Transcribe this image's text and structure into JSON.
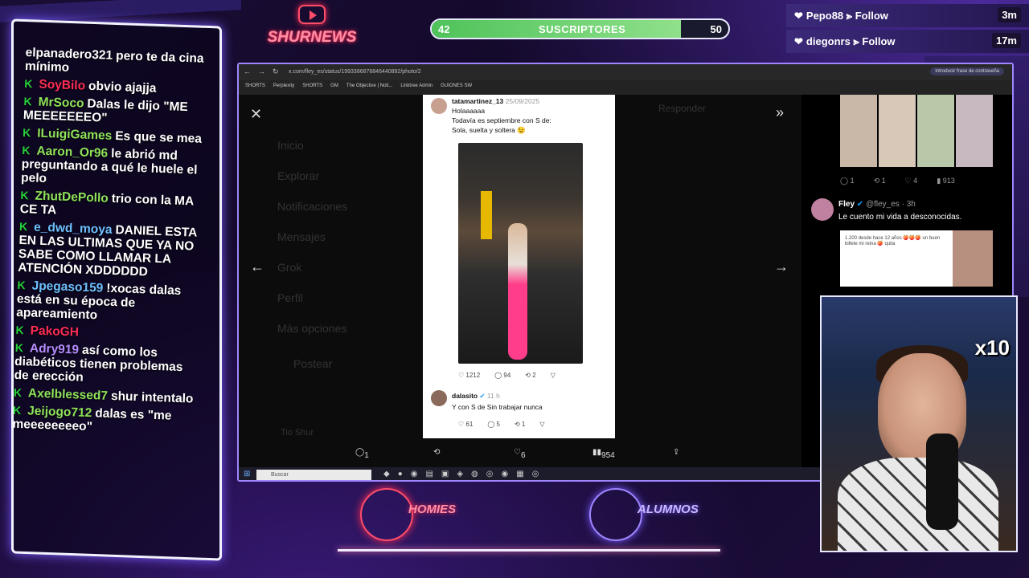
{
  "stream": {
    "logo_text": "SHURNEWS",
    "subs": {
      "current": "42",
      "label": "SUSCRIPTORES",
      "goal": "50",
      "progress": 0.84
    },
    "follows": [
      {
        "user": "Pepo88",
        "action": "Follow",
        "time": "3m"
      },
      {
        "user": "diegonrs",
        "action": "Follow",
        "time": "17m"
      }
    ],
    "x10": "x10",
    "homies": "HOMIES",
    "alumnos": "ALUMNOS"
  },
  "chat": [
    {
      "user": "elpanadero321",
      "color": "#ffffff",
      "text": "pero te da cina mínimo",
      "badge": false
    },
    {
      "user": "SoyBilo",
      "color": "#ff2d55",
      "text": "obvio ajajja",
      "badge": true
    },
    {
      "user": "MrSoco",
      "color": "#8fe35a",
      "text": "Dalas le dijo \"ME MEEEEEEEO\"",
      "badge": true
    },
    {
      "user": "ILuigiGames",
      "color": "#8fe35a",
      "text": "Es que se mea",
      "badge": true
    },
    {
      "user": "Aaron_Or96",
      "color": "#8fe35a",
      "text": "le abrió md preguntando a qué le huele el pelo",
      "badge": true
    },
    {
      "user": "ZhutDePollo",
      "color": "#8fe35a",
      "text": "trio con la MA CE TA",
      "badge": true
    },
    {
      "user": "e_dwd_moya",
      "color": "#6ec1ff",
      "text": "DANIEL ESTA EN LAS ULTIMAS QUE YA NO SABE COMO LLAMAR LA ATENCIÓN XDDDDDD",
      "badge": true
    },
    {
      "user": "Jpegaso159",
      "color": "#6ec1ff",
      "text": "!xocas dalas está en su época de apareamiento",
      "badge": true
    },
    {
      "user": "PakoGH",
      "color": "#ff2d55",
      "text": "",
      "badge": true
    },
    {
      "user": "Adry919",
      "color": "#b58cff",
      "text": "así como los diabéticos tienen problemas de erección",
      "badge": true
    },
    {
      "user": "Axelblessed7",
      "color": "#8fe35a",
      "text": "shur intentalo",
      "badge": true
    },
    {
      "user": "Jeijogo712",
      "color": "#8fe35a",
      "text": "dalas es \"me meeeeeeeeo\"",
      "badge": true
    }
  ],
  "browser": {
    "url": "x.com/fley_es/status/1993386876846440892/photo/2",
    "password_btn": "Introducir frase de contraseña",
    "bookmarks": [
      "SHORTS",
      "Perplexity",
      "SHORTS",
      "GM",
      "The Objective | Noti...",
      "Linktree Admin",
      "GUIONES SW"
    ],
    "sidebar": [
      "Inicio",
      "Explorar",
      "Notificaciones",
      "Mensajes",
      "Grok",
      "Perfil",
      "Más opciones",
      "Postear"
    ],
    "reply_btn": "Responder",
    "profile_name": "Tio Shur",
    "card": {
      "author": "tatamartinez_13",
      "date": "25/09/2025",
      "text1": "Holaaaaaa",
      "text2": "Todavía es septiembre con S de:",
      "text3": "Sola, suelta y soltera 😉",
      "likes": "1212",
      "comments": "94",
      "retweets": "2",
      "reply_author": "dalasito",
      "reply_time": "11 h",
      "reply_text": "Y con S de Sin trabajar nunca",
      "reply_likes": "61",
      "reply_comments": "5",
      "reply_rt": "1"
    },
    "bottom": {
      "comments": "1",
      "likes": "6",
      "views": "954"
    },
    "right": {
      "stats": [
        "1",
        "1",
        "4",
        "913"
      ],
      "author": "Fley",
      "handle": "@fley_es · 3h",
      "text": "Le cuento mi vida a desconocidas.",
      "preview_text": "1.200 desde hace 12 años 🍑🍑🍑 un buen billete mi reina 🍑 quita"
    },
    "taskbar_search": "Buscar"
  }
}
